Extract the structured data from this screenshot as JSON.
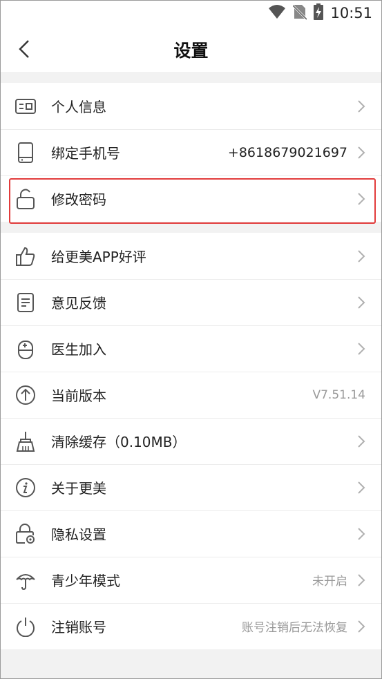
{
  "status": {
    "time": "10:51"
  },
  "header": {
    "title": "设置"
  },
  "group1": [
    {
      "label": "个人信息",
      "value": ""
    },
    {
      "label": "绑定手机号",
      "value": "+8618679021697"
    },
    {
      "label": "修改密码",
      "value": ""
    }
  ],
  "group2": [
    {
      "label": "给更美APP好评",
      "value": ""
    },
    {
      "label": "意见反馈",
      "value": ""
    },
    {
      "label": "医生加入",
      "value": ""
    },
    {
      "label": "当前版本",
      "value": "V7.51.14"
    },
    {
      "label": "清除缓存（0.10MB）",
      "value": ""
    },
    {
      "label": "关于更美",
      "value": ""
    },
    {
      "label": "隐私设置",
      "value": ""
    },
    {
      "label": "青少年模式",
      "value": "未开启"
    },
    {
      "label": "注销账号",
      "value": "账号注销后无法恢复"
    }
  ],
  "colors": {
    "highlight": "#e23b3b",
    "icon": "#555555",
    "chevron": "#b0b0b0"
  }
}
